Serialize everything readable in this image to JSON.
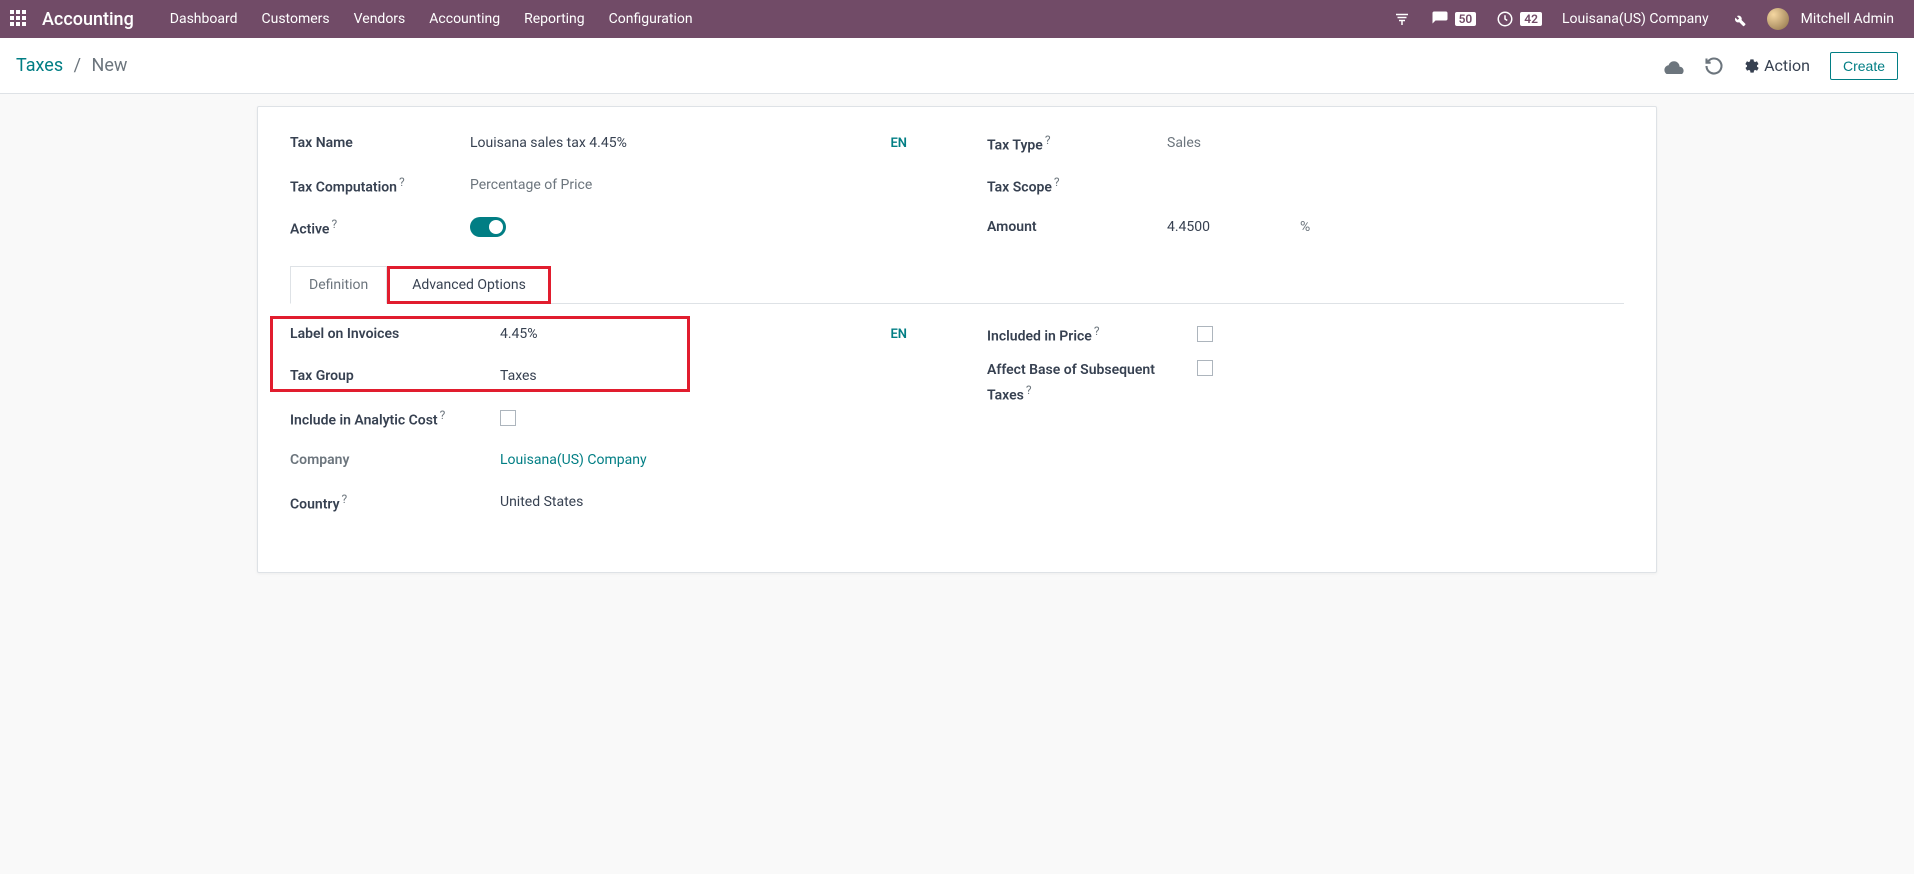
{
  "topbar": {
    "app_title": "Accounting",
    "nav": [
      "Dashboard",
      "Customers",
      "Vendors",
      "Accounting",
      "Reporting",
      "Configuration"
    ],
    "chat_badge": "50",
    "clock_badge": "42",
    "company": "Louisana(US) Company",
    "user": "Mitchell Admin"
  },
  "controlbar": {
    "breadcrumb_root": "Taxes",
    "breadcrumb_current": "New",
    "action_label": "Action",
    "create_label": "Create"
  },
  "form": {
    "tax_name_label": "Tax Name",
    "tax_name_value": "Louisana sales tax 4.45%",
    "tax_computation_label": "Tax Computation",
    "tax_computation_value": "Percentage of Price",
    "active_label": "Active",
    "lang": "EN",
    "tax_type_label": "Tax Type",
    "tax_type_value": "Sales",
    "tax_scope_label": "Tax Scope",
    "amount_label": "Amount",
    "amount_value": "4.4500",
    "amount_unit": "%"
  },
  "tabs": {
    "definition": "Definition",
    "advanced": "Advanced Options"
  },
  "advanced": {
    "label_on_invoices_label": "Label on Invoices",
    "label_on_invoices_value": "4.45%",
    "tax_group_label": "Tax Group",
    "tax_group_value": "Taxes",
    "include_analytic_label": "Include in Analytic Cost",
    "company_label": "Company",
    "company_value": "Louisana(US) Company",
    "country_label": "Country",
    "country_value": "United States",
    "lang": "EN",
    "included_in_price_label": "Included in Price",
    "affect_base_label": "Affect Base of Subsequent Taxes"
  }
}
